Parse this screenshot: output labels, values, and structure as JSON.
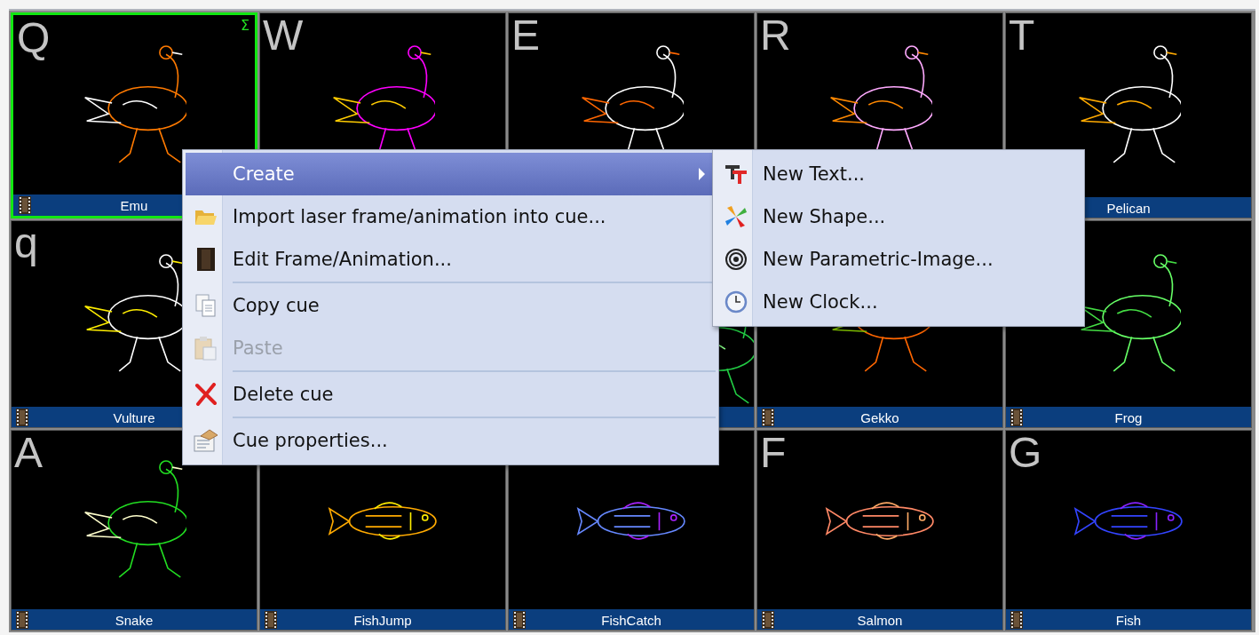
{
  "grid": {
    "cells": [
      {
        "key": "Q",
        "label": "Emu",
        "selected": true,
        "badge": "Σ"
      },
      {
        "key": "W",
        "selected": false
      },
      {
        "key": "E",
        "selected": false
      },
      {
        "key": "R",
        "selected": false
      },
      {
        "key": "T",
        "label": "Pelican",
        "selected": false
      },
      {
        "key": "q",
        "label": "Vulture",
        "selected": false
      },
      {},
      {
        "selected": false
      },
      {
        "label": "Gekko",
        "selected": false
      },
      {
        "label": "Frog",
        "selected": false
      },
      {
        "key": "A",
        "label": "Snake",
        "selected": false
      },
      {
        "label": "FishJump",
        "selected": false
      },
      {
        "label": "FishCatch",
        "selected": false
      },
      {
        "key": "F",
        "label": "Salmon",
        "selected": false
      },
      {
        "key": "G",
        "label": "Fish",
        "selected": false
      }
    ]
  },
  "context_menu": {
    "items": [
      {
        "kind": "item",
        "label": "Create",
        "highlighted": true,
        "has_submenu": true,
        "disabled": false
      },
      {
        "kind": "item",
        "label": "Import laser frame/animation into cue...",
        "highlighted": false,
        "has_submenu": false,
        "disabled": false
      },
      {
        "kind": "item",
        "label": "Edit Frame/Animation...",
        "highlighted": false,
        "has_submenu": false,
        "disabled": false
      },
      {
        "kind": "separator"
      },
      {
        "kind": "item",
        "label": "Copy cue",
        "highlighted": false,
        "has_submenu": false,
        "disabled": false
      },
      {
        "kind": "item",
        "label": "Paste",
        "highlighted": false,
        "has_submenu": false,
        "disabled": true
      },
      {
        "kind": "separator"
      },
      {
        "kind": "item",
        "label": "Delete cue",
        "highlighted": false,
        "has_submenu": false,
        "disabled": false
      },
      {
        "kind": "separator"
      },
      {
        "kind": "item",
        "label": "Cue properties...",
        "highlighted": false,
        "has_submenu": false,
        "disabled": false
      }
    ]
  },
  "submenu": {
    "items": [
      {
        "label": "New Text..."
      },
      {
        "label": "New Shape..."
      },
      {
        "label": "New Parametric-Image..."
      },
      {
        "label": "New Clock..."
      }
    ]
  }
}
